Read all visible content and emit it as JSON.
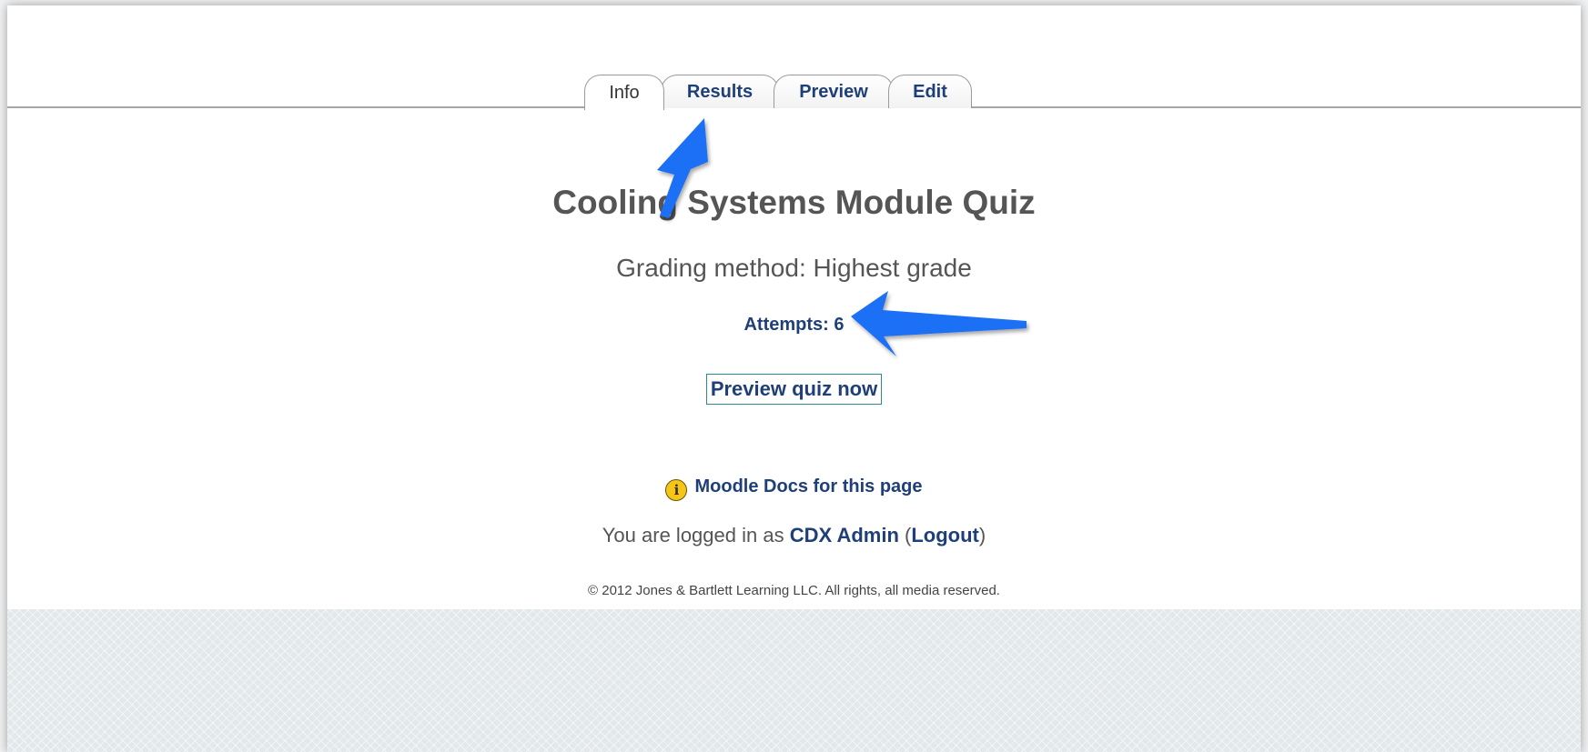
{
  "tabs": [
    {
      "label": "Info",
      "active": true
    },
    {
      "label": "Results",
      "active": false
    },
    {
      "label": "Preview",
      "active": false
    },
    {
      "label": "Edit",
      "active": false
    }
  ],
  "quiz": {
    "title": "Cooling Systems Module Quiz",
    "grading_method": "Grading method: Highest grade",
    "attempts": "Attempts: 6",
    "preview_button": "Preview quiz now"
  },
  "footer": {
    "docs_link": "Moodle Docs for this page",
    "docs_icon": "info-icon",
    "login_prefix": "You are logged in as",
    "user_name": "CDX Admin",
    "logout_label": "Logout",
    "copyright": "© 2012 Jones & Bartlett Learning LLC. All rights, all media reserved."
  },
  "annotations": {
    "arrow_color": "#1e6ff5"
  }
}
